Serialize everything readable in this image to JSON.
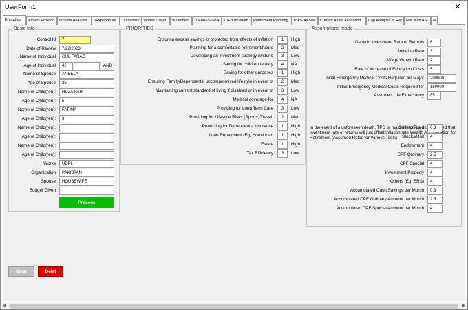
{
  "window": {
    "title": "UserForm1",
    "close": "✕"
  },
  "tabs": [
    "Entrgdata",
    "Assets Position",
    "Income Analysis",
    "6Expenditure",
    "7Disability",
    "Illness Cover",
    "9Lifelines",
    "10Edu&SaveA",
    "10Edu&SaveB",
    "Retirement Planning",
    "PIAS A&SW",
    "Current Asset Allocation",
    "Cap Analysis at Ret",
    "Net With ASL",
    "N"
  ],
  "basic_info": {
    "caption": "Basic Info",
    "fields": [
      {
        "label": "Control Id",
        "value": "7"
      },
      {
        "label": "Date of Review",
        "value": "7/22/2023"
      },
      {
        "label": "Name of Individual",
        "value": "GUL FARAZ"
      },
      {
        "label": "Age of Individual",
        "value": "42",
        "suffix": "ANB"
      },
      {
        "label": "Name of Spouse",
        "value": "ANEELA"
      },
      {
        "label": "Age of Spouse",
        "value": "25"
      },
      {
        "label": "Name of Child(ren):",
        "value": "HUZAIFAH"
      },
      {
        "label": "Age of Child(ren):",
        "value": "5"
      },
      {
        "label": "Name of Child(ren):",
        "value": "FATIMA"
      },
      {
        "label": "Age of Child(ren):",
        "value": "3"
      },
      {
        "label": "Name of Child(ren):",
        "value": ""
      },
      {
        "label": "Age of Child(ren):",
        "value": ""
      },
      {
        "label": "Name of Child(ren):",
        "value": ""
      },
      {
        "label": "Age of Child(ren):",
        "value": ""
      },
      {
        "label": "Works",
        "value": "UDPL"
      },
      {
        "label": "Organization",
        "value": "PAKISTAN"
      },
      {
        "label": "Spouse",
        "value": "HOUSEWIFE"
      },
      {
        "label": "Budget Given",
        "value": ""
      }
    ],
    "process_label": "Process"
  },
  "priorities": {
    "caption": "PRIORITIES",
    "items": [
      {
        "label": "Ensuring excess savings is protected from effects of inflation",
        "rank": "1",
        "level": "High"
      },
      {
        "label": "Planning for a comfortable retirement/future",
        "rank": "2",
        "level": "Med"
      },
      {
        "label": "Developing an investment strategy (with/no",
        "rank": "3",
        "level": "Low"
      },
      {
        "label": "Saving for children tertiary",
        "rank": "4",
        "level": "NA"
      },
      {
        "label": "Saving for other purposes",
        "rank": "1",
        "level": "High"
      },
      {
        "label": "Ensuring Family/Dependents' uncompromised lifestyle in event of",
        "rank": "2",
        "level": "Med"
      },
      {
        "label": "Maintaining current standard of living if disabled or in event of",
        "rank": "3",
        "level": "Low"
      },
      {
        "label": "Medical coverage for",
        "rank": "4",
        "level": "NA"
      },
      {
        "label": "Providing for Long Term Care",
        "rank": "3",
        "level": "Low"
      },
      {
        "label": "Providing for Lifestyle Risks (Sports, Travel,",
        "rank": "2",
        "level": "Med"
      },
      {
        "label": "Protecting for Dependents' insurance",
        "rank": "1",
        "level": "High"
      },
      {
        "label": "Loan Repayment (Eg, Home loan",
        "rank": "1",
        "level": "High"
      },
      {
        "label": "Estate",
        "rank": "1",
        "level": "High"
      },
      {
        "label": "Tax Efficiency",
        "rank": "3",
        "level": "Low"
      }
    ]
  },
  "assumptions": {
    "caption": "Assumptions made",
    "top": [
      {
        "label": "Generic Investment Rate of Returns",
        "value": "6"
      },
      {
        "label": "Inflation Rate",
        "value": "3"
      },
      {
        "label": "Wage Growth Rate",
        "value": "2"
      },
      {
        "label": "Rate of Increase of Education Costs",
        "value": "5"
      },
      {
        "label": "Initial Emergency Medical Costs Required for Major",
        "value": "200000"
      },
      {
        "label": "Initial Emergency Medical Costs Required for",
        "value": "150000"
      },
      {
        "label": "Assumed Life Expectancy",
        "value": "85"
      }
    ],
    "note": "In the event of a unforeseen death, TPD or major illnesses, it is assumed that investment rate of returns will just offset inflation rate Wealth Accumulation for Retirement (Assumed Rates for Various Tools)",
    "rates": [
      {
        "label": "Saving/Fixed",
        "value": "0.3"
      },
      {
        "label": "Stocks/Unit",
        "value": "4"
      },
      {
        "label": "Endowment",
        "value": "4"
      },
      {
        "label": "CPF Ordinary",
        "value": "2.5"
      },
      {
        "label": "CPF Special",
        "value": "4"
      },
      {
        "label": "Investment Property",
        "value": "4"
      },
      {
        "label": "Others (Eq, SRS)",
        "value": "4"
      },
      {
        "label": "Accumulated Cash Savings per Month",
        "value": "0.3"
      },
      {
        "label": "Accumulated CPF Ordinary Account per Month",
        "value": "2.5"
      },
      {
        "label": "Accumulated CPF Special Account per Month",
        "value": "4"
      }
    ]
  },
  "actions": {
    "clear": "Clear",
    "delete": "Delet"
  },
  "scrollbar": {
    "left": "◀",
    "right": "▶"
  }
}
